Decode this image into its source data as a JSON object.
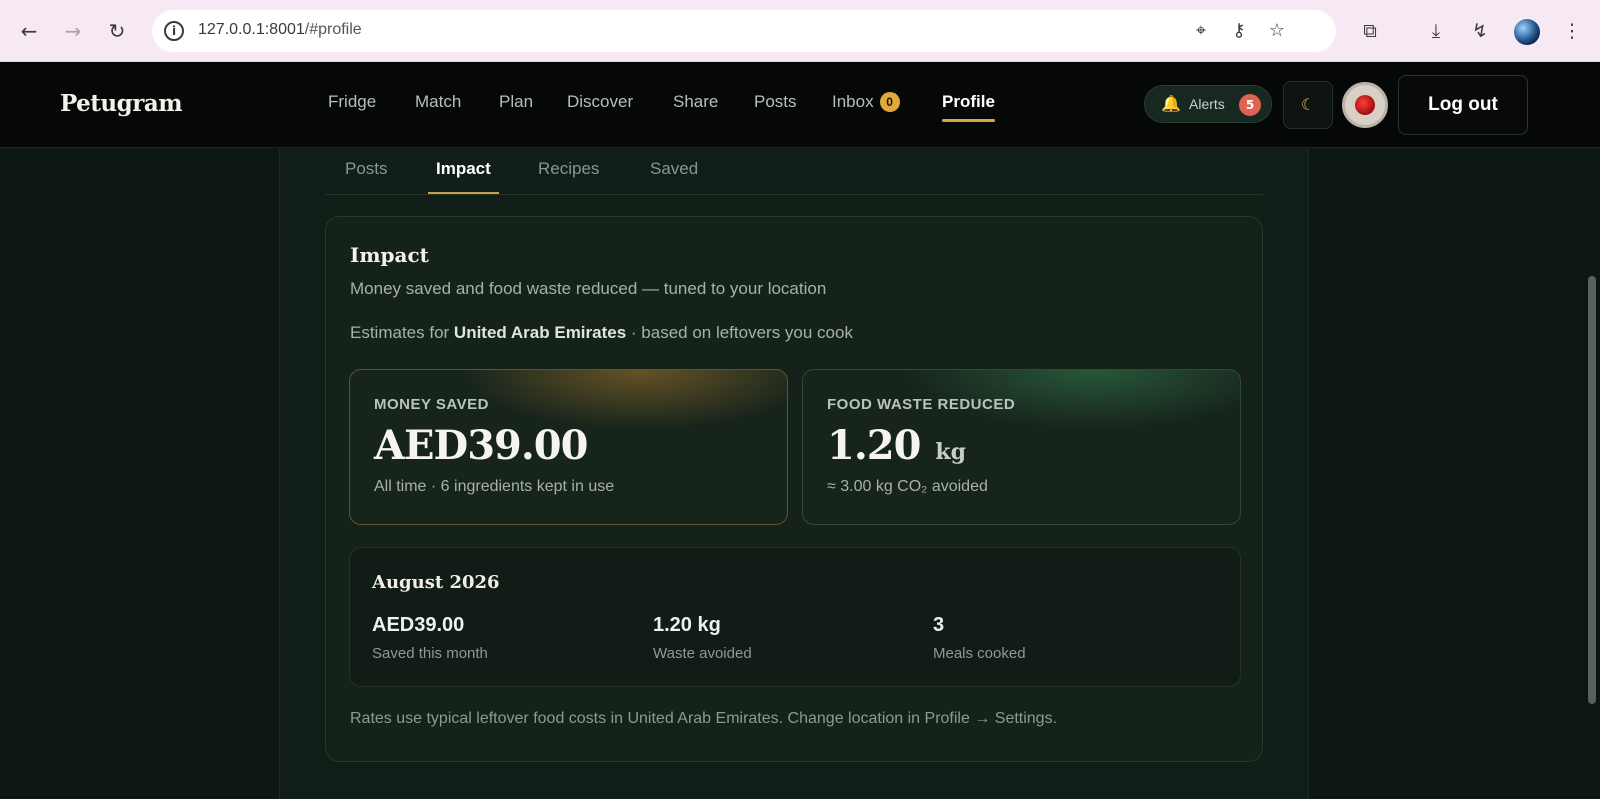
{
  "browser": {
    "url_host": "127.0.0.1:8001",
    "url_path": "/#profile"
  },
  "header": {
    "logo": "Petugram",
    "nav": [
      {
        "label": "Fridge"
      },
      {
        "label": "Match"
      },
      {
        "label": "Plan"
      },
      {
        "label": "Discover"
      },
      {
        "label": "Share"
      },
      {
        "label": "Posts"
      },
      {
        "label": "Inbox",
        "badge": "0"
      },
      {
        "label": "Profile",
        "active": true
      }
    ],
    "alerts_label": "Alerts",
    "alerts_count": "5",
    "theme_icon": "moon-icon",
    "logout_label": "Log out"
  },
  "profile_tabs": [
    {
      "label": "Posts"
    },
    {
      "label": "Impact",
      "active": true
    },
    {
      "label": "Recipes"
    },
    {
      "label": "Saved"
    }
  ],
  "impact": {
    "title": "Impact",
    "subtitle": "Money saved and food waste reduced — tuned to your location",
    "estimate_prefix": "Estimates for ",
    "estimate_country": "United Arab Emirates",
    "estimate_suffix": " · based on leftovers you cook",
    "money": {
      "label": "MONEY SAVED",
      "value": "AED39.00",
      "foot": "All time · 6 ingredients kept in use"
    },
    "waste": {
      "label": "FOOD WASTE REDUCED",
      "value": "1.20",
      "unit": "kg",
      "foot": "≈ 3.00 kg CO₂ avoided"
    },
    "month": {
      "title": "August 2026",
      "stats": [
        {
          "value": "AED39.00",
          "label": "Saved this month"
        },
        {
          "value": "1.20 kg",
          "label": "Waste avoided"
        },
        {
          "value": "3",
          "label": "Meals cooked"
        }
      ]
    },
    "note": "Rates use typical leftover food costs in United Arab Emirates. Change location in Profile → Settings."
  },
  "colors": {
    "accent_gold": "#d9a54a",
    "alert_red": "#e06250",
    "page_bg": "#0d1712"
  }
}
